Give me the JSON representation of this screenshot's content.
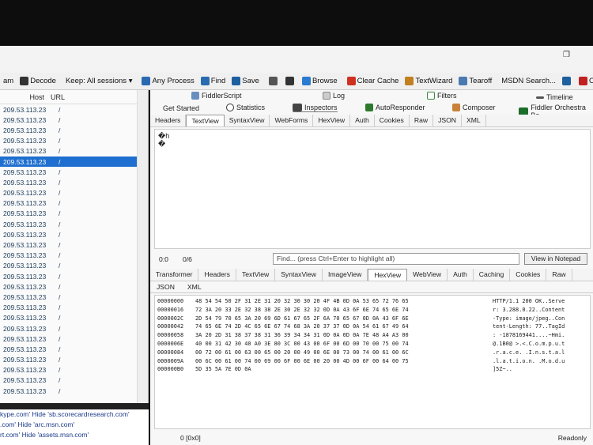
{
  "window_controls": {
    "restore": "❐"
  },
  "toolbar": {
    "items": [
      {
        "label": "am",
        "icon": "unknown-icon"
      },
      {
        "label": "Decode",
        "icon": "decode-icon"
      },
      {
        "label": "Keep: All sessions ▾",
        "icon": ""
      },
      {
        "label": "Any Process",
        "icon": "crosshair-icon"
      },
      {
        "label": "Find",
        "icon": "binoculars-icon"
      },
      {
        "label": "Save",
        "icon": "save-icon"
      },
      {
        "label": "",
        "icon": "camera-icon"
      },
      {
        "label": "",
        "icon": "timer-icon"
      },
      {
        "label": "Browse",
        "icon": "globe-icon"
      },
      {
        "label": "Clear Cache",
        "icon": "clear-cache-icon"
      },
      {
        "label": "TextWizard",
        "icon": "textwizard-icon"
      },
      {
        "label": "Tearoff",
        "icon": "tearoff-icon"
      },
      {
        "label": "MSDN Search...",
        "icon": ""
      },
      {
        "label": "",
        "icon": "help-icon"
      },
      {
        "label": "Offline",
        "icon": "offline-icon"
      }
    ]
  },
  "sessions": {
    "col_host": "Host",
    "col_url": "URL",
    "rows": [
      {
        "host": "209.53.113.23",
        "url": "/"
      },
      {
        "host": "209.53.113.23",
        "url": "/"
      },
      {
        "host": "209.53.113.23",
        "url": "/"
      },
      {
        "host": "209.53.113.23",
        "url": "/"
      },
      {
        "host": "209.53.113.23",
        "url": "/"
      },
      {
        "host": "209.53.113.23",
        "url": "/"
      },
      {
        "host": "209.53.113.23",
        "url": "/"
      },
      {
        "host": "209.53.113.23",
        "url": "/"
      },
      {
        "host": "209.53.113.23",
        "url": "/"
      },
      {
        "host": "209.53.113.23",
        "url": "/"
      },
      {
        "host": "209.53.113.23",
        "url": "/"
      },
      {
        "host": "209.53.113.23",
        "url": "/"
      },
      {
        "host": "209.53.113.23",
        "url": "/"
      },
      {
        "host": "209.53.113.23",
        "url": "/"
      },
      {
        "host": "209.53.113.23",
        "url": "/"
      },
      {
        "host": "209.53.113.23",
        "url": "/"
      },
      {
        "host": "209.53.113.23",
        "url": "/"
      },
      {
        "host": "209.53.113.23",
        "url": "/"
      },
      {
        "host": "209.53.113.23",
        "url": "/"
      },
      {
        "host": "209.53.113.23",
        "url": "/"
      },
      {
        "host": "209.53.113.23",
        "url": "/"
      },
      {
        "host": "209.53.113.23",
        "url": "/"
      },
      {
        "host": "209.53.113.23",
        "url": "/"
      },
      {
        "host": "209.53.113.23",
        "url": "/"
      },
      {
        "host": "209.53.113.23",
        "url": "/"
      },
      {
        "host": "209.53.113.23",
        "url": "/"
      },
      {
        "host": "209.53.113.23",
        "url": "/"
      },
      {
        "host": "209.53.113.23",
        "url": "/"
      }
    ],
    "selected_index": 5
  },
  "filters_bar": {
    "lines": [
      "kype.com'  Hide 'sb.scorecardresearch.com'",
      ".com'  Hide 'arc.msn.com'",
      "rt.com'  Hide 'assets.msn.com'"
    ]
  },
  "main_tabs": {
    "fiddlerscript": "FiddlerScript",
    "log": "Log",
    "filters": "Filters",
    "timeline": "Timeline",
    "get_started": "Get Started",
    "statistics": "Statistics",
    "inspectors": "Inspectors",
    "autoresponder": "AutoResponder",
    "composer": "Composer",
    "orchestra": "Fiddler Orchestra Be"
  },
  "request_tabs": [
    "Headers",
    "TextView",
    "SyntaxView",
    "WebForms",
    "HexView",
    "Auth",
    "Cookies",
    "Raw",
    "JSON",
    "XML"
  ],
  "request_active": 1,
  "request_body": {
    "line1": "�h",
    "line2": "�"
  },
  "request_status": {
    "pos": "0:0",
    "count": "0/6",
    "find_placeholder": "Find... (press Ctrl+Enter to highlight all)",
    "notepad": "View in Notepad"
  },
  "response_tabs": [
    "Transformer",
    "Headers",
    "TextView",
    "SyntaxView",
    "ImageView",
    "HexView",
    "WebView",
    "Auth",
    "Caching",
    "Cookies",
    "Raw"
  ],
  "response_active": 5,
  "response_tabs2": [
    "JSON",
    "XML"
  ],
  "hex_rows": [
    {
      "off": "00000000",
      "bytes": "48 54 54 50 2F 31 2E 31 20 32 30 30 20 4F 4B 0D 0A 53 65 72 76 65",
      "ascii": "HTTP/1.1 200 OK..Serve"
    },
    {
      "off": "00000016",
      "bytes": "72 3A 20 33 2E 32 38 38 2E 30 2E 32 32 0D 0A 43 6F 6E 74 65 6E 74",
      "ascii": "r: 3.288.0.22..Content"
    },
    {
      "off": "0000002C",
      "bytes": "2D 54 79 70 65 3A 20 69 6D 61 67 65 2F 6A 70 65 67 0D 0A 43 6F 6E",
      "ascii": "-Type: image/jpeg..Con"
    },
    {
      "off": "00000042",
      "bytes": "74 65 6E 74 2D 4C 65 6E 67 74 68 3A 20 37 37 0D 0A 54 61 67 49 64",
      "ascii": "tent-Length: 77..TagId"
    },
    {
      "off": "00000058",
      "bytes": "3A 20 2D 31 38 37 38 31 36 39 34 34 31 0D 0A 0D 0A 7E 48 A4 A3 00",
      "ascii": ": -1878169441....~Hmi."
    },
    {
      "off": "0000006E",
      "bytes": "40 00 31 42 30 40 A0 3E 80 3C 00 43 00 6F 00 6D 00 70 00 75 00 74",
      "ascii": "@.1B0@ >.<.C.o.m.p.u.t"
    },
    {
      "off": "00000084",
      "bytes": "00 72 00 61 00 63 00 65 00 20 00 49 00 6E 00 73 00 74 00 61 00 6C",
      "ascii": ".r.a.c.e. .I.n.s.t.a.l"
    },
    {
      "off": "0000009A",
      "bytes": "00 6C 00 61 00 74 00 69 00 6F 00 6E 00 20 00 4D 00 6F 00 64 00 75",
      "ascii": ".l.a.t.i.o.n. .M.o.d.u"
    },
    {
      "off": "000000B0",
      "bytes": "5D 35 5A 7E 0D 0A",
      "ascii": "]5Z~.."
    }
  ],
  "footer": {
    "position": "0 [0x0]",
    "readonly": "Readonly"
  },
  "colors": {
    "selection": "#1e6fd0",
    "link": "#1a3a8a"
  }
}
